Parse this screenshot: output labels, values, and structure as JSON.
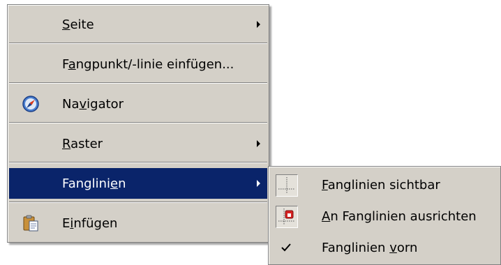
{
  "menu": {
    "items": [
      {
        "label": "Seite",
        "mnemonic_index": 0,
        "has_submenu": true
      },
      {
        "label": "Fangpunkt/-linie einfügen...",
        "mnemonic_index": 1,
        "has_submenu": false
      },
      {
        "label": "Navigator",
        "mnemonic_index": 2,
        "icon": "navigator-compass-icon",
        "has_submenu": false
      },
      {
        "label": "Raster",
        "mnemonic_index": 0,
        "has_submenu": true
      },
      {
        "label": "Fanglinien",
        "mnemonic_index": 8,
        "has_submenu": true,
        "active": true
      },
      {
        "label": "Einfügen",
        "mnemonic_index": 1,
        "icon": "paste-clipboard-icon",
        "has_submenu": false
      }
    ]
  },
  "submenu": {
    "items": [
      {
        "label": "Fanglinien sichtbar",
        "mnemonic_index": 0,
        "icon": "snap-lines-visible-icon",
        "checked": true
      },
      {
        "label": "An Fanglinien ausrichten",
        "mnemonic_index": 0,
        "icon": "snap-to-lines-icon",
        "checked": true
      },
      {
        "label": "Fanglinien vorn",
        "mnemonic_index": 11,
        "icon": "checkmark-icon",
        "checked": true
      }
    ]
  },
  "colors": {
    "menu_bg": "#d4d0c8",
    "highlight_bg": "#0a246a",
    "highlight_text": "#ffffff"
  }
}
